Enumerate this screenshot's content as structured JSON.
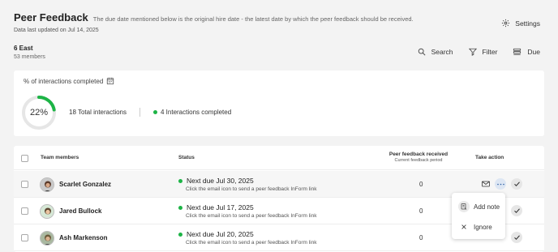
{
  "header": {
    "title": "Peer Feedback",
    "subtitle": "The due date mentioned below is the original hire date - the latest date by which the peer feedback should be received.",
    "updated": "Data last updated on Jul 14, 2025",
    "settings_label": "Settings"
  },
  "unit": {
    "name": "6 East",
    "members": "53 members"
  },
  "toolbar": {
    "search": "Search",
    "filter": "Filter",
    "due": "Due"
  },
  "summary": {
    "title": "% of interactions completed",
    "percent_label": "22%",
    "percent": 22,
    "total": "18 Total interactions",
    "completed": "4 Interactions completed"
  },
  "table": {
    "headers": {
      "members": "Team members",
      "status": "Status",
      "feedback": "Peer feedback received",
      "feedback_sub": "Current feedback period",
      "action": "Take action"
    },
    "rows": [
      {
        "name": "Scarlet Gonzalez",
        "status": "Next due Jul 30, 2025",
        "hint": "Click the email icon to send a peer feedback InForm link",
        "count": "0"
      },
      {
        "name": "Jared Bullock",
        "status": "Next due Jul 17, 2025",
        "hint": "Click the email icon to send a peer feedback InForm link",
        "count": "0"
      },
      {
        "name": "Ash Markenson",
        "status": "Next due Jul 20, 2025",
        "hint": "Click the email icon to send a peer feedback InForm link",
        "count": "0"
      }
    ]
  },
  "popover": {
    "add_note": "Add note",
    "ignore": "Ignore"
  },
  "colors": {
    "accent_green": "#1db446",
    "ring_track": "#e6e6e6",
    "background": "#f3f3f3"
  }
}
